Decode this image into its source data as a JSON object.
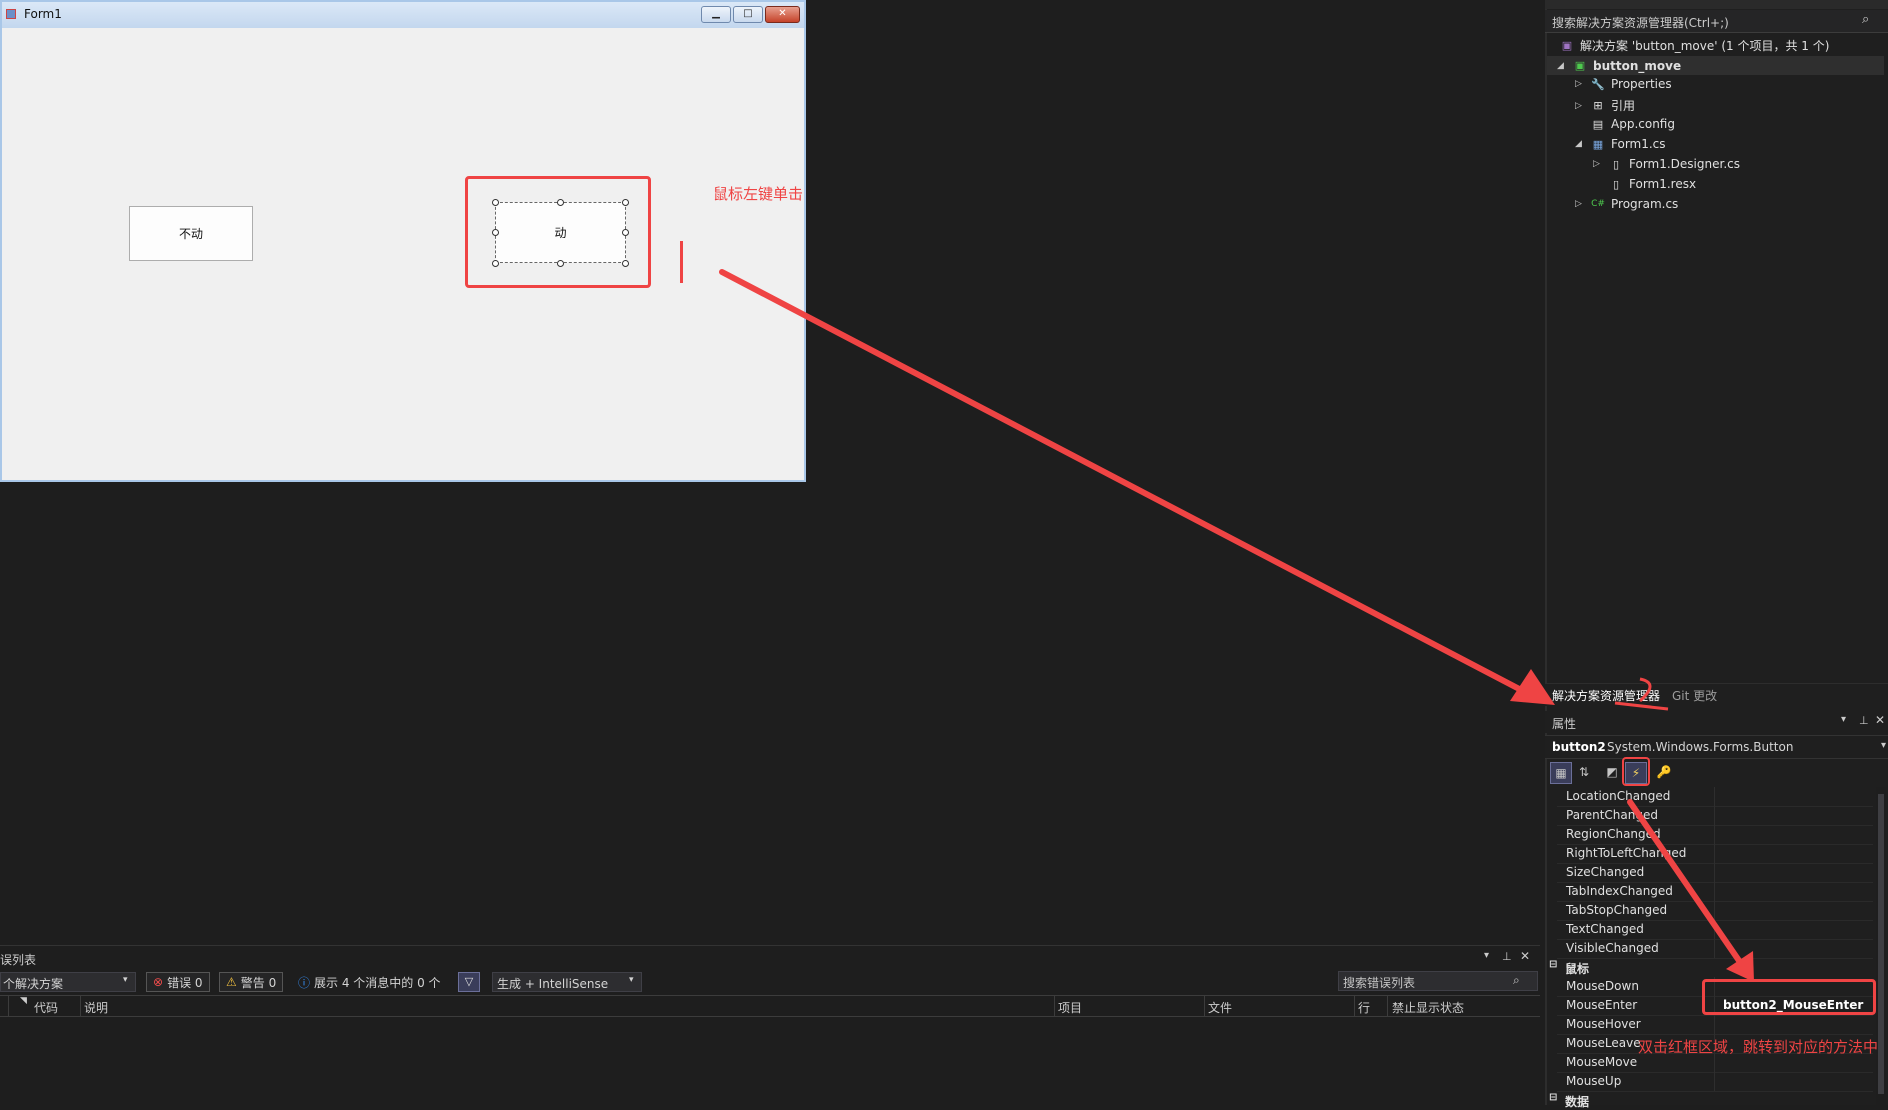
{
  "form": {
    "title": "Form1",
    "min_label": "▁",
    "max_label": "□",
    "close_label": "✕",
    "button1_label": "不动",
    "button2_label": "动"
  },
  "annotations": {
    "click_note": "鼠标左键单击",
    "double_click_note": "双击红框区域，跳转到对应的方法中"
  },
  "solution_explorer": {
    "search_placeholder": "搜索解决方案资源管理器(Ctrl+;)",
    "search_icon": "⌕",
    "solution_label": "解决方案 'button_move' (1 个项目，共 1 个)",
    "project": "button_move",
    "items": [
      {
        "label": "Properties",
        "icon": "wrench-icon"
      },
      {
        "label": "引用",
        "icon": "references-icon"
      },
      {
        "label": "App.config",
        "icon": "config-file-icon"
      },
      {
        "label": "Form1.cs",
        "icon": "form-icon"
      },
      {
        "label": "Form1.Designer.cs",
        "icon": "cs-file-icon"
      },
      {
        "label": "Form1.resx",
        "icon": "resx-file-icon"
      },
      {
        "label": "Program.cs",
        "icon": "csharp-icon"
      }
    ],
    "tabs": [
      "解决方案资源管理器",
      "Git 更改"
    ]
  },
  "properties": {
    "title": "属性",
    "object_name": "button2",
    "object_type": "System.Windows.Forms.Button",
    "events": [
      {
        "name": "LocationChanged",
        "value": ""
      },
      {
        "name": "ParentChanged",
        "value": ""
      },
      {
        "name": "RegionChanged",
        "value": ""
      },
      {
        "name": "RightToLeftChanged",
        "value": ""
      },
      {
        "name": "SizeChanged",
        "value": ""
      },
      {
        "name": "TabIndexChanged",
        "value": ""
      },
      {
        "name": "TabStopChanged",
        "value": ""
      },
      {
        "name": "TextChanged",
        "value": ""
      },
      {
        "name": "VisibleChanged",
        "value": ""
      }
    ],
    "category_mouse": "鼠标",
    "mouse_events": [
      {
        "name": "MouseDown",
        "value": ""
      },
      {
        "name": "MouseEnter",
        "value": "button2_MouseEnter"
      },
      {
        "name": "MouseHover",
        "value": ""
      },
      {
        "name": "MouseLeave",
        "value": ""
      },
      {
        "name": "MouseMove",
        "value": ""
      },
      {
        "name": "MouseUp",
        "value": ""
      }
    ],
    "category_data": "数据"
  },
  "error_list": {
    "title": "误列表",
    "scope": "个解决方案",
    "errors": "错误 0",
    "warnings": "警告 0",
    "messages": "展示 4 个消息中的 0 个",
    "build_filter": "生成 + IntelliSense",
    "search_placeholder": "搜索错误列表",
    "columns": [
      "代码",
      "说明",
      "项目",
      "文件",
      "行",
      "禁止显示状态"
    ]
  },
  "colors": {
    "annotation_red": "#ef4444",
    "ide_background": "#1e1e1e",
    "form_background": "#f0f0f0"
  }
}
